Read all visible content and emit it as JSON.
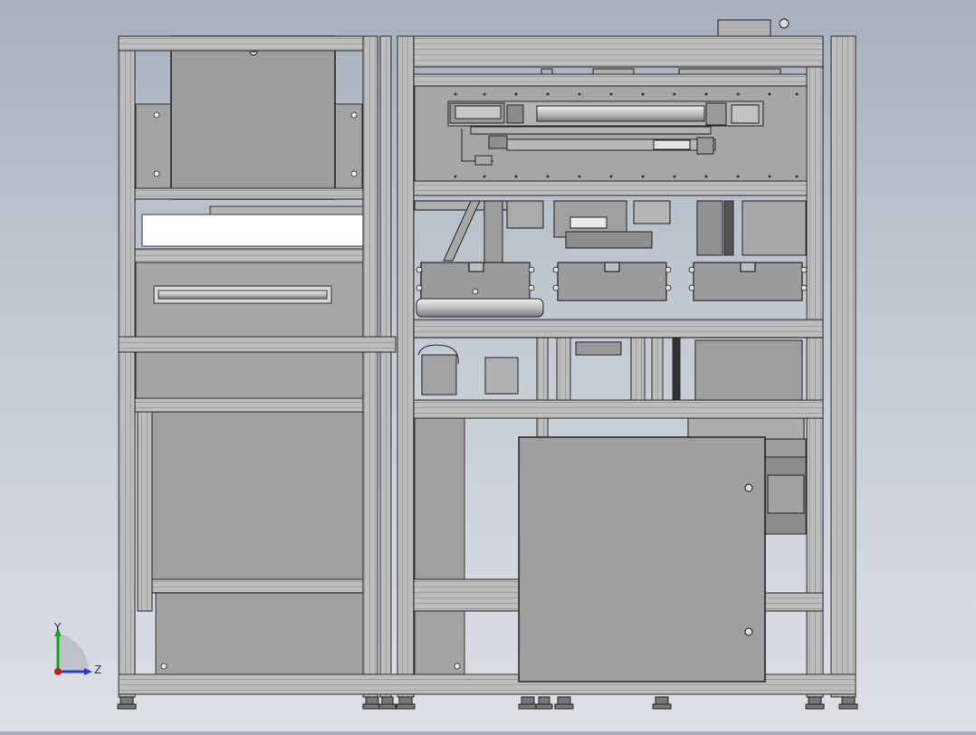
{
  "viewport": {
    "background_top": "#a7b0bd",
    "background_bottom": "#dde0e5",
    "frame_color": "#bcbcbc",
    "frame_edge": "#2a2a2a",
    "panel_color": "#9e9e9e",
    "plate_color": "#a8a8a8"
  },
  "triad": {
    "y_label": "Y",
    "z_label": "Z",
    "y_color": "#1aa51a",
    "z_color": "#2a3ad6",
    "x_color": "#c81e1e"
  }
}
